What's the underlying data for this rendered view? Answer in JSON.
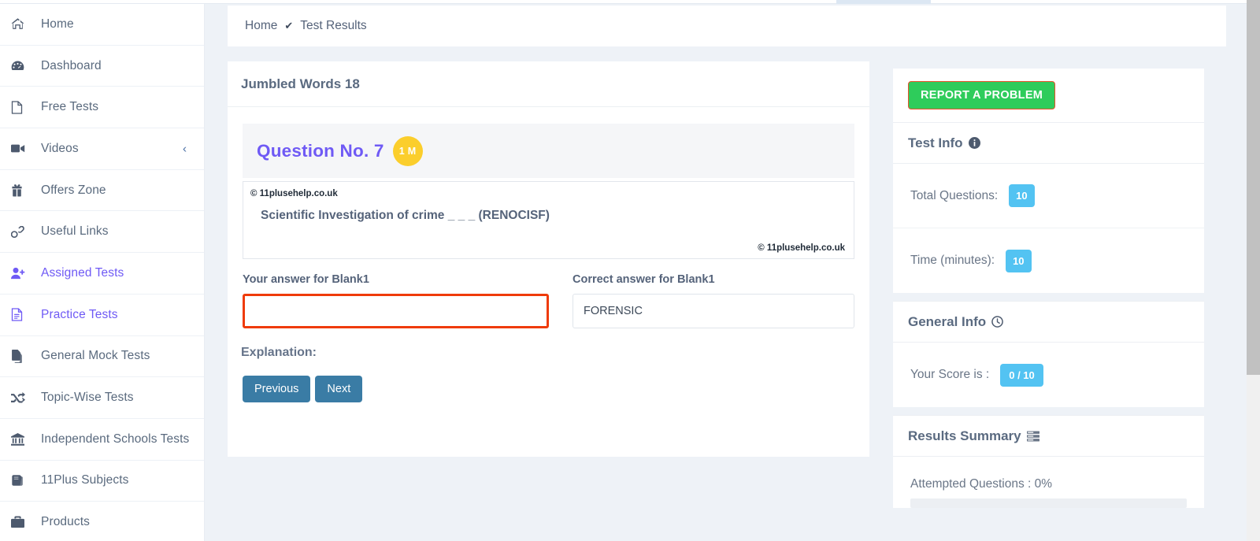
{
  "sidebar": {
    "items": [
      {
        "label": "Home",
        "icon": "home-icon",
        "active": false,
        "chevron": null
      },
      {
        "label": "Dashboard",
        "icon": "dashboard-icon",
        "active": false,
        "chevron": null
      },
      {
        "label": "Free Tests",
        "icon": "file-icon",
        "active": false,
        "chevron": null
      },
      {
        "label": "Videos",
        "icon": "video-camera-icon",
        "active": false,
        "chevron": "‹"
      },
      {
        "label": "Offers Zone",
        "icon": "gift-icon",
        "active": false,
        "chevron": null
      },
      {
        "label": "Useful Links",
        "icon": "link-icon",
        "active": false,
        "chevron": null
      },
      {
        "label": "Assigned Tests",
        "icon": "user-plus-icon",
        "active": true,
        "chevron": null
      },
      {
        "label": "Practice Tests",
        "icon": "document-list-icon",
        "active": true,
        "chevron": null
      },
      {
        "label": "General Mock Tests",
        "icon": "copy-icon",
        "active": false,
        "chevron": null
      },
      {
        "label": "Topic-Wise Tests",
        "icon": "shuffle-icon",
        "active": false,
        "chevron": null
      },
      {
        "label": "Independent Schools Tests",
        "icon": "bank-icon",
        "active": false,
        "chevron": null
      },
      {
        "label": "11Plus Subjects",
        "icon": "book-icon",
        "active": false,
        "chevron": null
      },
      {
        "label": "Products",
        "icon": "briefcase-icon",
        "active": false,
        "chevron": null
      }
    ]
  },
  "breadcrumb": {
    "home": "Home",
    "separator": "✔",
    "current": "Test Results"
  },
  "content": {
    "title": "Jumbled Words 18",
    "question": {
      "label": "Question No. 7",
      "marks_badge": "1 M",
      "copyright_top": "© 11plusehelp.co.uk",
      "text": "Scientific Investigation of crime _ _ _ (RENOCISF)",
      "copyright_bottom": "© 11plusehelp.co.uk"
    },
    "your_answer_label": "Your answer for Blank1",
    "your_answer_value": "",
    "your_answer_placeholder": "",
    "correct_answer_label": "Correct answer for Blank1",
    "correct_answer_value": "FORENSIC",
    "explanation_label": "Explanation:",
    "previous_button": "Previous",
    "next_button": "Next"
  },
  "right_panel": {
    "report_button": "REPORT A PROBLEM",
    "test_info": {
      "heading": "Test Info",
      "heading_icon": "info-circle-icon",
      "rows": [
        {
          "label": "Total Questions:",
          "value": "10"
        },
        {
          "label": "Time (minutes):",
          "value": "10"
        }
      ]
    },
    "general_info": {
      "heading": "General Info",
      "heading_icon": "clock-icon",
      "rows": [
        {
          "label": "Your Score is :",
          "value": "0 / 10"
        }
      ]
    },
    "results_summary": {
      "heading": "Results Summary",
      "heading_icon": "list-bars-icon",
      "attempted_label": "Attempted Questions : 0%",
      "attempted_percent": 0
    }
  },
  "colors": {
    "accent_purple": "#6f5af5",
    "badge_yellow": "#fbce2c",
    "pill_blue": "#53c3f2",
    "button_blue": "#3a7ca5",
    "report_green": "#2ecc5b",
    "report_border": "#e8512a",
    "input_error": "#ef3b09",
    "page_bg": "#eef2f7"
  }
}
